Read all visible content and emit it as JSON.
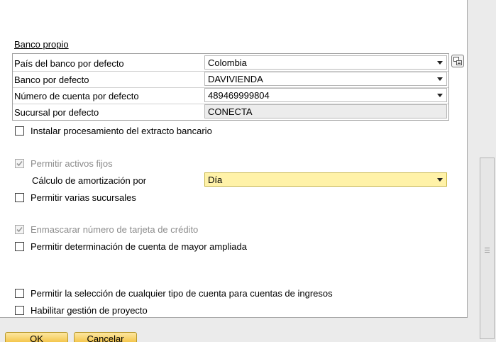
{
  "bank": {
    "section_title": "Banco propio",
    "rows": [
      {
        "label": "País del banco por defecto",
        "value": "Colombia"
      },
      {
        "label": "Banco por defecto",
        "value": "DAVIVIENDA"
      },
      {
        "label": "Número de cuenta por defecto",
        "value": "489469999804"
      },
      {
        "label": "Sucursal por defecto",
        "value": "CONECTA"
      }
    ]
  },
  "options": {
    "bank_statement": "Instalar procesamiento del extracto bancario",
    "fixed_assets": "Permitir activos fijos",
    "depreciation_label": "Cálculo de amortización por",
    "depreciation_value": "Día",
    "multiple_branches": "Permitir varias sucursales",
    "mask_card": "Enmascarar número de tarjeta de crédito",
    "extended_gl": "Permitir determinación de cuenta de mayor ampliada",
    "any_revenue_account": "Permitir la selección de cualquier tipo de cuenta para cuentas de ingresos",
    "project_mgmt": "Habilitar gestión de proyecto"
  },
  "buttons": {
    "ok": "OK",
    "cancel": "Cancelar"
  },
  "colors": {
    "highlight_field": "#fff2a8",
    "button_gold": "#f4c64d"
  }
}
